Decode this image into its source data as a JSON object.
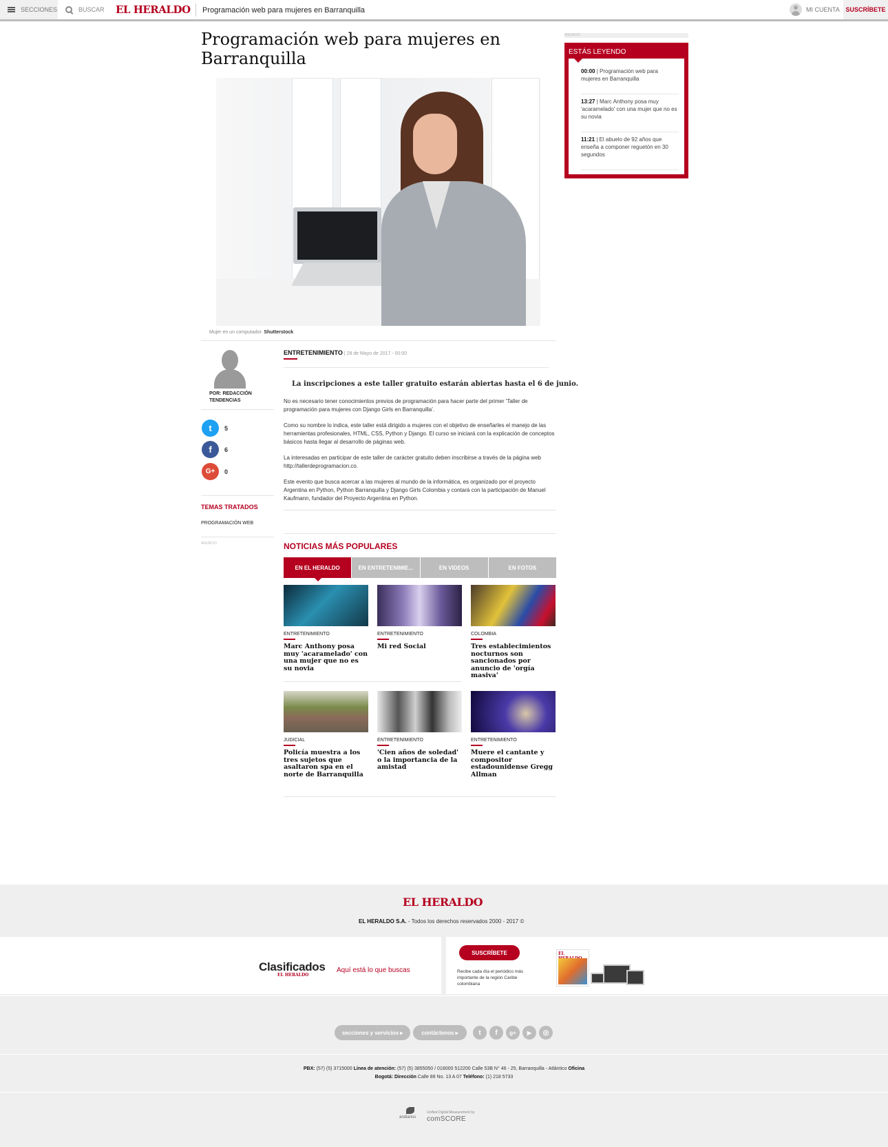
{
  "topbar": {
    "secciones_label": "SECCIONES",
    "buscar_label": "BUSCAR",
    "logo": "EL HERALDO",
    "article_title": "Programación web para mujeres en Barranquilla",
    "cuenta_label": "MI CUENTA",
    "suscribete_label": "SUSCRÍBETE"
  },
  "article": {
    "title": "Programación web para mujeres en Barranquilla",
    "caption_text": "Mujer en un computador.",
    "caption_credit": "Shutterstock",
    "section": "ENTRETENIMIENTO",
    "date": "| 28 de Mayo de 2017 - 00:00",
    "lead": "La inscripciones a este taller gratuito estarán abiertas hasta el 6 de junio.",
    "paragraphs": [
      "No es necesario tener conocimientos previos de programación para hacer parte del primer 'Taller de programación para mujeres con Django Girls en Barranquilla'.",
      "Como su nombre lo indica, este taller está dirigido a mujeres con el objetivo de enseñarles el manejo de las herramientas profesionales, HTML, CSS, Python y Django. El curso se iniciará con la explicación de conceptos básicos hasta llegar al desarrollo de páginas web.",
      "La interesadas en  participar de este taller de carácter gratuito deben inscribirse a través de la página web http://tallerdeprogramacion.co.",
      "Este evento que busca acercar a las mujeres al mundo de la informática, es organizado por el proyecto Argentina en Python, Python Barranquilla y Django Girls Colombia y contará con la participación de Manuel Kaufmann, fundador del Proyecto Argentina en Python."
    ]
  },
  "author": {
    "name": "POR: REDACCIÓN TENDENCIAS"
  },
  "share": {
    "twitter_glyph": "t",
    "twitter_count": "5",
    "facebook_glyph": "f",
    "facebook_count": "6",
    "google_glyph": "G+",
    "google_count": "0"
  },
  "temas": {
    "heading": "TEMAS TRATADOS",
    "items": [
      "PROGRAMACIÓN WEB"
    ],
    "anuncio": "ANUNCIO"
  },
  "sidebar": {
    "anuncio": "ANUNCIO",
    "heading": "ESTÁS LEYENDO",
    "items": [
      {
        "time": "00:00",
        "text": "| Programación web para mujeres en Barranquilla"
      },
      {
        "time": "13:27",
        "text": "| Marc Anthony posa muy 'acaramelado' con una mujer que no es su novia"
      },
      {
        "time": "11:21",
        "text": "| El abuelo de 92 años que enseña a componer reguetón en 30 segundos"
      }
    ]
  },
  "populares": {
    "heading": "NOTICIAS MÁS POPULARES",
    "tabs": [
      "EN EL HERALDO",
      "EN ENTRETENIMIE...",
      "EN VIDEOS",
      "EN FOTOS"
    ],
    "cards": [
      {
        "category": "ENTRETENIMIENTO",
        "title": "Marc Anthony posa muy 'acaramelado' con una mujer que no es su novia"
      },
      {
        "category": "ENTRETENIMIENTO",
        "title": "Mi red Social"
      },
      {
        "category": "COLOMBIA",
        "title": "Tres establecimientos nocturnos son sancionados por anuncio de 'orgía masiva'"
      },
      {
        "category": "JUDICIAL",
        "title": "Policía muestra a los tres sujetos que asaltaron spa en el norte de Barranquilla"
      },
      {
        "category": "ENTRETENIMIENTO",
        "title": "'Cien años de soledad' o la importancia de la amistad"
      },
      {
        "category": "ENTRETENIMIENTO",
        "title": "Muere el cantante y compositor estadounidense Gregg Allman"
      }
    ]
  },
  "footer": {
    "logo": "EL HERALDO",
    "company": "EL HERALDO S.A.",
    "rights": " - Todos los derechos reservados 2000 - 2017 ©",
    "clasificados": "Clasificados",
    "clasificados_sub": "EL HERALDO",
    "clasificados_tag": "Aquí está lo que buscas",
    "subscribe_btn": "SUSCRÍBETE",
    "subscribe_text": "Recibe cada día el periódico más importante de la región Caribe colombiana",
    "paper_logo": "EL HERALDO",
    "links": [
      "secciones y servicios ▸",
      "contáctenos ▸"
    ],
    "social": [
      "t",
      "f",
      "g+",
      "▶",
      "◎"
    ],
    "contact_line1": [
      {
        "label": "PBX:",
        "value": " (57) (5) 3715000 "
      },
      {
        "label": "Línea de atención:",
        "value": " (57) (5) 3855050 / 018000 512200 Calle 53B N° 46 - 25, Barranquilla - Atlántico "
      },
      {
        "label": "Oficina",
        "value": ""
      }
    ],
    "contact_line2": [
      {
        "label": "Bogotá: Dirección",
        "value": " Calle 88 No. 13 A 07 "
      },
      {
        "label": "Teléfono:",
        "value": " (1) 218 5733"
      }
    ],
    "andiarios": "andiarios",
    "comscore_small": "Unified Digital Measurement by",
    "comscore": "comSCORE"
  },
  "colors": {
    "brand_red": "#b5001f",
    "twitter": "#1da1f2",
    "facebook": "#3b5998",
    "google": "#dd4b39"
  }
}
